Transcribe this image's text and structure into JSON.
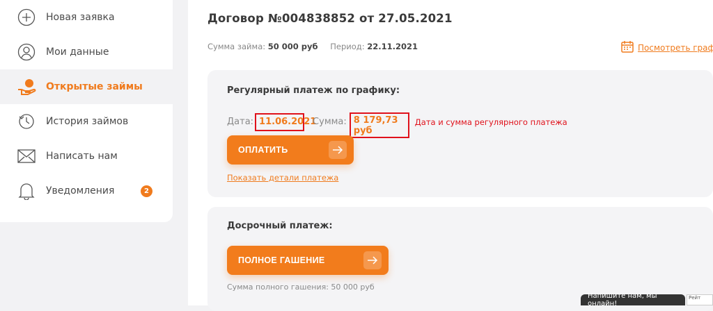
{
  "sidebar": {
    "items": [
      {
        "label": "Новая заявка",
        "icon": "plus-circle-icon"
      },
      {
        "label": "Мои данные",
        "icon": "user-icon"
      },
      {
        "label": "Открытые займы",
        "icon": "hand-coin-icon",
        "active": true
      },
      {
        "label": "История займов",
        "icon": "history-icon"
      },
      {
        "label": "Написать нам",
        "icon": "envelope-icon"
      },
      {
        "label": "Уведомления",
        "icon": "bell-icon",
        "badge": "2"
      }
    ]
  },
  "contract": {
    "title": "Договор №004838852 от 27.05.2021",
    "sum_label": "Сумма займа:",
    "sum_value": "50 000 руб",
    "period_label": "Период:",
    "period_value": "22.11.2021",
    "schedule_link": "Посмотреть графи"
  },
  "regular": {
    "title": "Регулярный платеж по графику:",
    "date_label": "Дата:",
    "date_value": "11.06.2021",
    "sum_label": "Сумма:",
    "sum_value": "8 179,73 руб",
    "annotation": "Дата и сумма регулярного платежа",
    "pay_button": "ОПЛАТИТЬ",
    "details_link": "Показать детали платежа"
  },
  "early": {
    "title": "Досрочный платеж:",
    "full_button": "ПОЛНОЕ ГАШЕНИЕ",
    "full_sum_text": "Сумма полного гашения: 50 000 руб"
  },
  "chat": {
    "label": "Напишите нам, мы онлайн!",
    "rating": "Рейт"
  },
  "colors": {
    "accent": "#f27c1c",
    "annotation_red": "#e0111b"
  }
}
